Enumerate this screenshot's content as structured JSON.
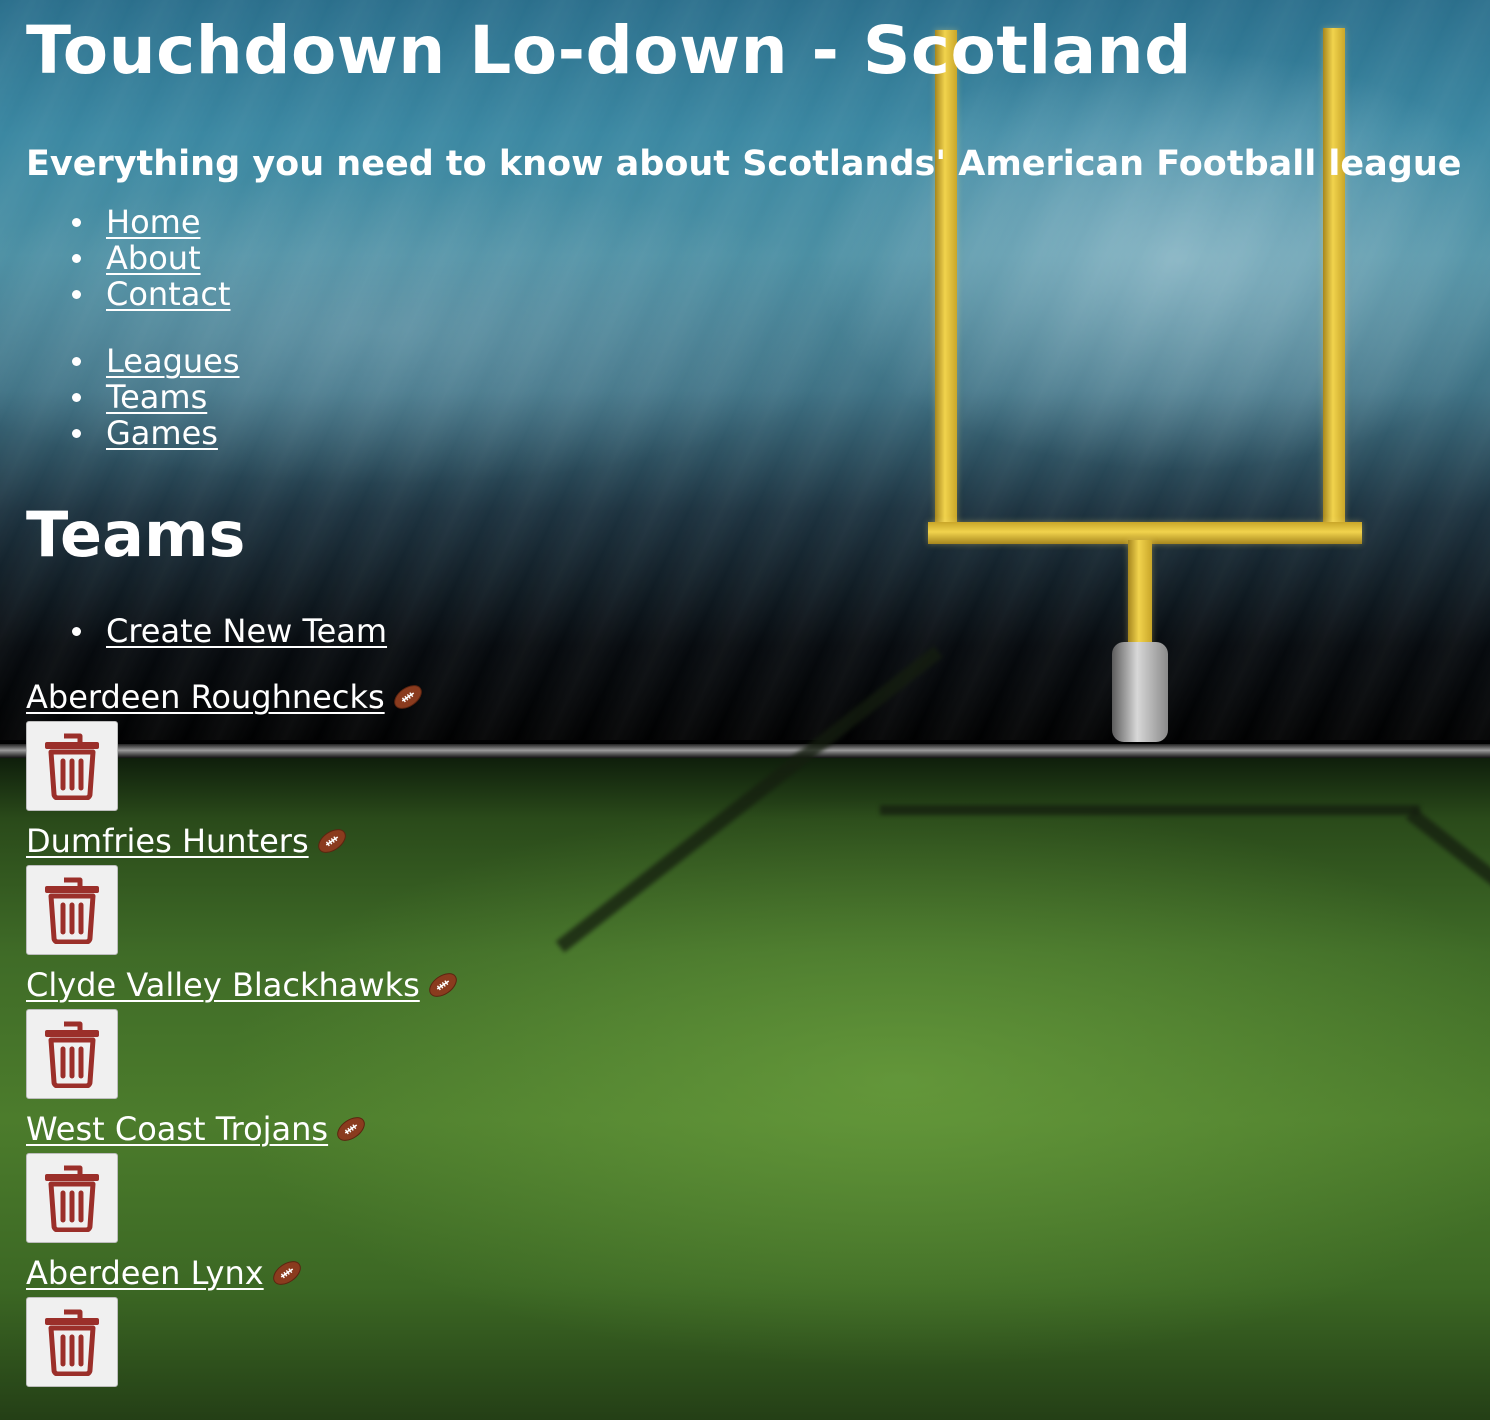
{
  "header": {
    "title": "Touchdown Lo-down - Scotland",
    "subtitle": "Everything you need to know about Scotlands' American Football league"
  },
  "nav_main": [
    {
      "label": "Home"
    },
    {
      "label": "About"
    },
    {
      "label": "Contact"
    }
  ],
  "nav_sections": [
    {
      "label": "Leagues"
    },
    {
      "label": "Teams"
    },
    {
      "label": "Games"
    }
  ],
  "page": {
    "heading": "Teams",
    "create_link": "Create New Team"
  },
  "teams": [
    {
      "name": "Aberdeen Roughnecks",
      "icon": "football-icon"
    },
    {
      "name": "Dumfries Hunters",
      "icon": "football-icon"
    },
    {
      "name": "Clyde Valley Blackhawks",
      "icon": "football-icon"
    },
    {
      "name": "West Coast Trojans",
      "icon": "football-icon"
    },
    {
      "name": "Aberdeen Lynx",
      "icon": "football-icon"
    }
  ],
  "colors": {
    "text": "#ffffff",
    "trash_icon": "#9b2f2a",
    "button_bg": "#f0f0f0"
  }
}
